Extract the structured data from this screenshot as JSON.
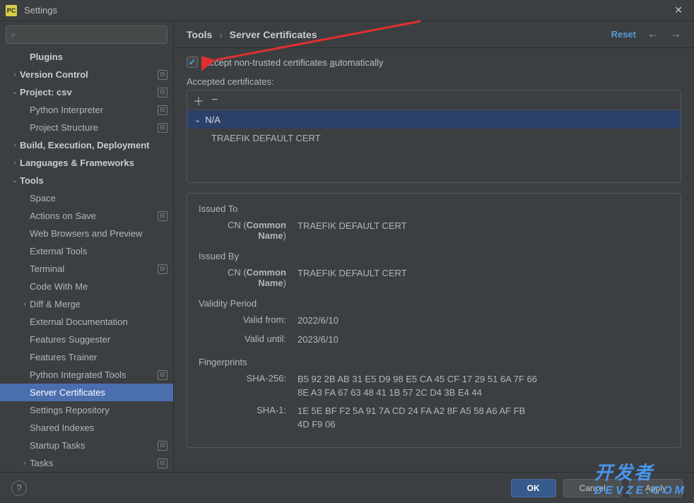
{
  "window": {
    "title": "Settings",
    "app_icon": "PC"
  },
  "search": {
    "placeholder": ""
  },
  "sidebar": {
    "items": [
      {
        "label": "Plugins",
        "depth": 1,
        "bold": true,
        "expander": "",
        "modified": false
      },
      {
        "label": "Version Control",
        "depth": 0,
        "bold": true,
        "expander": "›",
        "modified": true
      },
      {
        "label": "Project: csv",
        "depth": 0,
        "bold": true,
        "expander": "⌄",
        "modified": true
      },
      {
        "label": "Python Interpreter",
        "depth": 1,
        "bold": false,
        "expander": "",
        "modified": true
      },
      {
        "label": "Project Structure",
        "depth": 1,
        "bold": false,
        "expander": "",
        "modified": true
      },
      {
        "label": "Build, Execution, Deployment",
        "depth": 0,
        "bold": true,
        "expander": "›",
        "modified": false
      },
      {
        "label": "Languages & Frameworks",
        "depth": 0,
        "bold": true,
        "expander": "›",
        "modified": false
      },
      {
        "label": "Tools",
        "depth": 0,
        "bold": true,
        "expander": "⌄",
        "modified": false
      },
      {
        "label": "Space",
        "depth": 1,
        "bold": false,
        "expander": "",
        "modified": false
      },
      {
        "label": "Actions on Save",
        "depth": 1,
        "bold": false,
        "expander": "",
        "modified": true
      },
      {
        "label": "Web Browsers and Preview",
        "depth": 1,
        "bold": false,
        "expander": "",
        "modified": false
      },
      {
        "label": "External Tools",
        "depth": 1,
        "bold": false,
        "expander": "",
        "modified": false
      },
      {
        "label": "Terminal",
        "depth": 1,
        "bold": false,
        "expander": "",
        "modified": true
      },
      {
        "label": "Code With Me",
        "depth": 1,
        "bold": false,
        "expander": "",
        "modified": false
      },
      {
        "label": "Diff & Merge",
        "depth": 1,
        "bold": false,
        "expander": "›",
        "modified": false
      },
      {
        "label": "External Documentation",
        "depth": 1,
        "bold": false,
        "expander": "",
        "modified": false
      },
      {
        "label": "Features Suggester",
        "depth": 1,
        "bold": false,
        "expander": "",
        "modified": false
      },
      {
        "label": "Features Trainer",
        "depth": 1,
        "bold": false,
        "expander": "",
        "modified": false
      },
      {
        "label": "Python Integrated Tools",
        "depth": 1,
        "bold": false,
        "expander": "",
        "modified": true
      },
      {
        "label": "Server Certificates",
        "depth": 1,
        "bold": false,
        "expander": "",
        "modified": false,
        "selected": true
      },
      {
        "label": "Settings Repository",
        "depth": 1,
        "bold": false,
        "expander": "",
        "modified": false
      },
      {
        "label": "Shared Indexes",
        "depth": 1,
        "bold": false,
        "expander": "",
        "modified": false
      },
      {
        "label": "Startup Tasks",
        "depth": 1,
        "bold": false,
        "expander": "",
        "modified": true
      },
      {
        "label": "Tasks",
        "depth": 1,
        "bold": false,
        "expander": "›",
        "modified": true
      }
    ]
  },
  "breadcrumb": {
    "root": "Tools",
    "leaf": "Server Certificates"
  },
  "header_actions": {
    "reset": "Reset"
  },
  "checkbox": {
    "label_pre": "Accept non-trusted certificates ",
    "label_u": "a",
    "label_post": "utomatically",
    "checked": true
  },
  "accepted_label": "Accepted certificates:",
  "cert_group": "N/A",
  "cert_entry": "TRAEFIK DEFAULT CERT",
  "details": {
    "issued_to": {
      "header": "Issued To",
      "cn_label": "CN (",
      "cn_bold": "Common Name",
      "cn_close": ")",
      "cn_value": "TRAEFIK DEFAULT CERT"
    },
    "issued_by": {
      "header": "Issued By",
      "cn_label": "CN (",
      "cn_bold": "Common Name",
      "cn_close": ")",
      "cn_value": "TRAEFIK DEFAULT CERT"
    },
    "validity": {
      "header": "Validity Period",
      "from_label": "Valid from:",
      "from_value": "2022/6/10",
      "until_label": "Valid until:",
      "until_value": "2023/6/10"
    },
    "fingerprints": {
      "header": "Fingerprints",
      "sha256_label": "SHA-256:",
      "sha256_value": "B5 92 2B AB 31 E5 D9 98 E5 CA 45 CF 17 29 51 6A 7F 66 8E A3 FA 67 63 48 41 1B 57 2C D4 3B E4 44",
      "sha1_label": "SHA-1:",
      "sha1_value": "1E 5E BF F2 5A 91 7A CD 24 FA A2 8F A5 58 A6 AF FB 4D F9 06"
    }
  },
  "footer": {
    "ok": "OK",
    "cancel": "Cancel",
    "apply": "Apply"
  },
  "watermark": {
    "line1": "开发者",
    "line2": "DEVZE.COM"
  }
}
